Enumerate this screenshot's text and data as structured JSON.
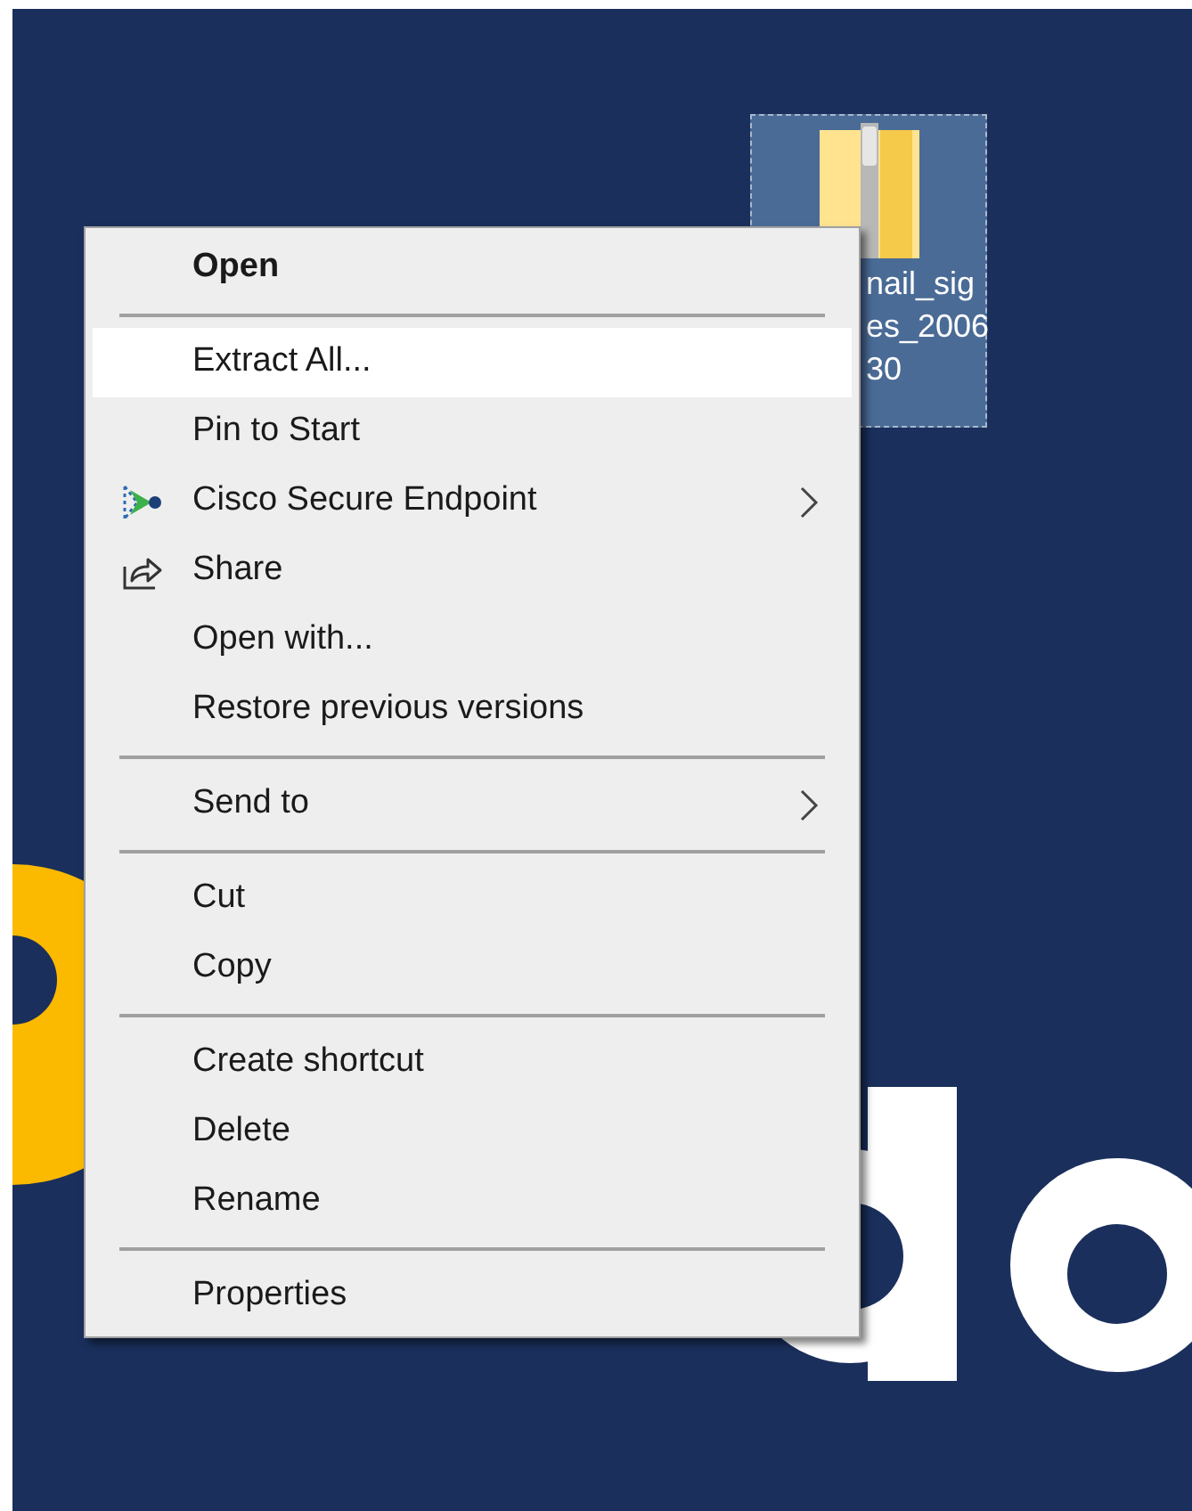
{
  "desktop_icon": {
    "label_lines": [
      "nail_sig",
      "es_2006",
      "30"
    ],
    "selected": true
  },
  "context_menu": {
    "items": [
      {
        "kind": "item",
        "label": "Open",
        "bold": true,
        "selected": false
      },
      {
        "kind": "separator"
      },
      {
        "kind": "item",
        "label": "Extract All...",
        "selected": true
      },
      {
        "kind": "item",
        "label": "Pin to Start",
        "selected": false
      },
      {
        "kind": "app_item",
        "label": "Cisco Secure Endpoint",
        "submenu": true,
        "selected": false
      },
      {
        "kind": "share_item",
        "label": "Share",
        "selected": false
      },
      {
        "kind": "item",
        "label": "Open with...",
        "selected": false
      },
      {
        "kind": "item",
        "label": "Restore previous versions",
        "selected": false
      },
      {
        "kind": "separator"
      },
      {
        "kind": "item",
        "label": "Send to",
        "submenu": true,
        "selected": false
      },
      {
        "kind": "separator"
      },
      {
        "kind": "item",
        "label": "Cut",
        "selected": false
      },
      {
        "kind": "item",
        "label": "Copy",
        "selected": false
      },
      {
        "kind": "separator"
      },
      {
        "kind": "item",
        "label": "Create shortcut",
        "selected": false
      },
      {
        "kind": "item",
        "label": "Delete",
        "selected": false
      },
      {
        "kind": "item",
        "label": "Rename",
        "selected": false
      },
      {
        "kind": "separator"
      },
      {
        "kind": "item",
        "label": "Properties",
        "selected": false
      }
    ]
  }
}
